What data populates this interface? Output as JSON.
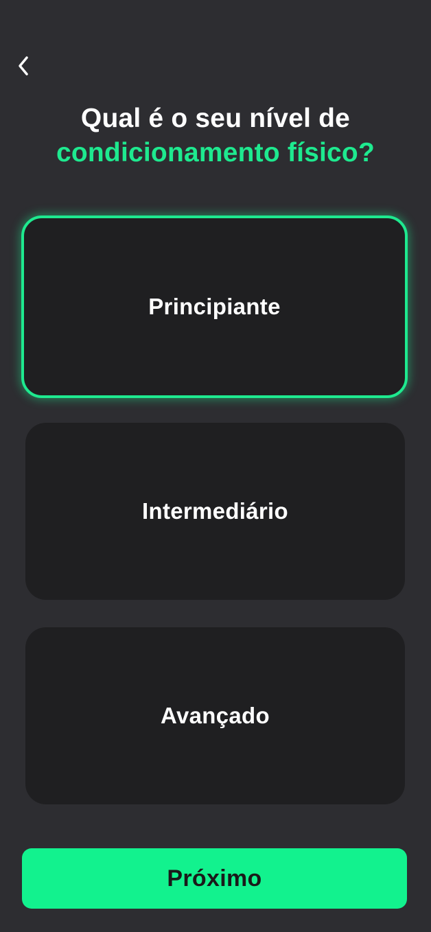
{
  "header": {
    "back_icon": "chevron-left-icon"
  },
  "question": {
    "line1": "Qual é o seu nível de",
    "line2": "condicionamento físico?"
  },
  "options": [
    {
      "label": "Principiante",
      "selected": true
    },
    {
      "label": "Intermediário",
      "selected": false
    },
    {
      "label": "Avançado",
      "selected": false
    }
  ],
  "footer": {
    "next_label": "Próximo"
  },
  "colors": {
    "background": "#2d2d31",
    "card": "#1f1f21",
    "accent": "#1ee98f",
    "button": "#12f28e"
  }
}
